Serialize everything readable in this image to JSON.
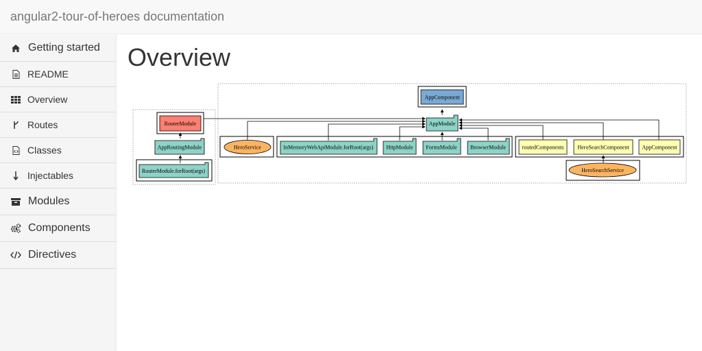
{
  "header": {
    "title": "angular2-tour-of-heroes documentation"
  },
  "sidebar": {
    "items": [
      {
        "label": "Getting started",
        "icon": "home-icon"
      },
      {
        "label": "README",
        "icon": "file-text-icon"
      },
      {
        "label": "Overview",
        "icon": "grid-icon"
      },
      {
        "label": "Routes",
        "icon": "branch-icon"
      },
      {
        "label": "Classes",
        "icon": "file-code-icon"
      },
      {
        "label": "Injectables",
        "icon": "arrow-down-icon"
      },
      {
        "label": "Modules",
        "icon": "archive-icon"
      },
      {
        "label": "Components",
        "icon": "cogs-icon"
      },
      {
        "label": "Directives",
        "icon": "code-icon"
      }
    ]
  },
  "main": {
    "title": "Overview"
  },
  "graph": {
    "nodes": {
      "app_component_top": "AppComponent",
      "router_module": "RouterModule",
      "app_routing_module": "AppRoutingModule",
      "router_for_root": "RouterModule.forRoot(args)",
      "app_module": "AppModule",
      "hero_service": "HeroService",
      "in_memory": "InMemoryWebApiModule.forRoot(args)",
      "http_module": "HttpModule",
      "forms_module": "FormsModule",
      "browser_module": "BrowserModule",
      "routed_components": "routedComponents",
      "hero_search_component": "HeroSearchComponent",
      "app_component": "AppComponent",
      "hero_search_service": "HeroSearchService"
    },
    "colors": {
      "component": "#7aa9d3",
      "module": "#8dd3c7",
      "router": "#fb8072",
      "service": "#fdb462",
      "declaration": "#ffffb3"
    }
  }
}
